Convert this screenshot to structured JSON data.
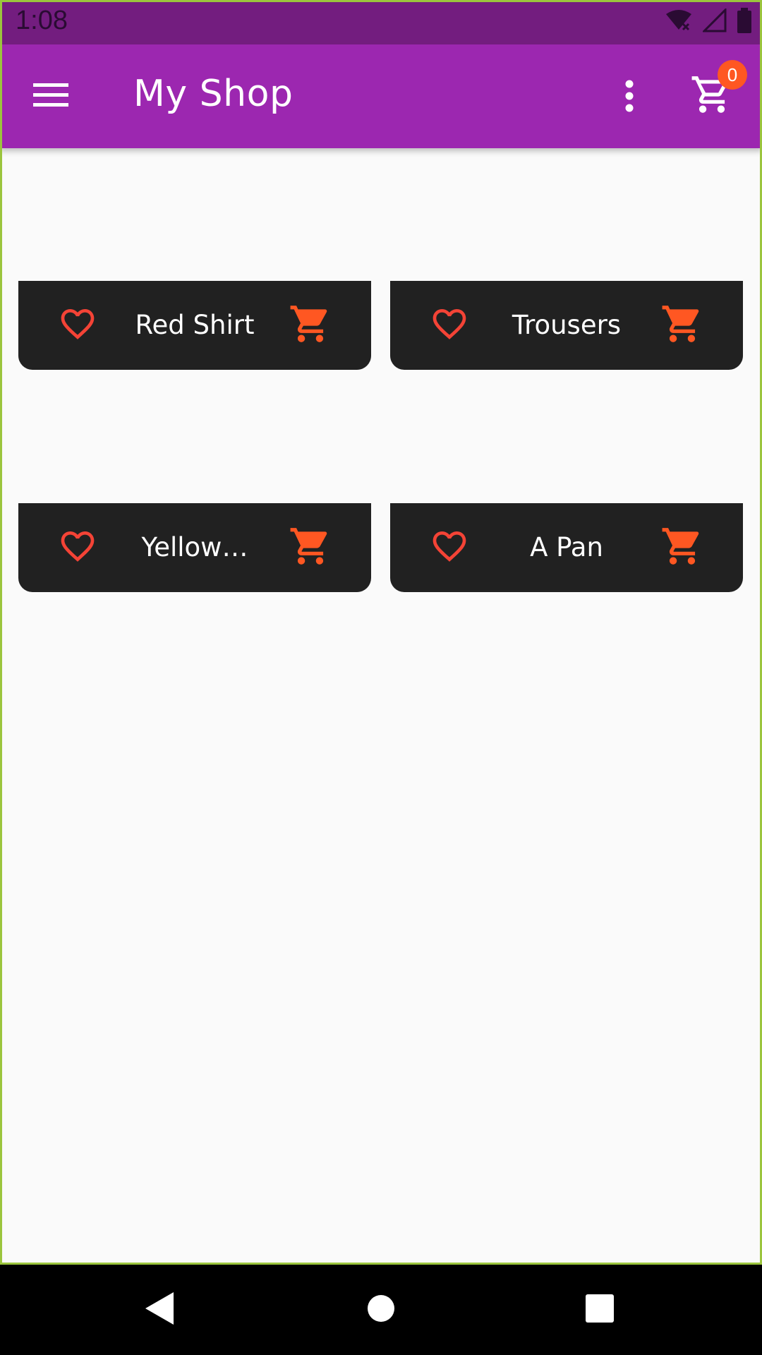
{
  "status_bar": {
    "time": "1:08",
    "icons": [
      "wifi-off-icon",
      "cell-signal-icon",
      "battery-icon"
    ]
  },
  "app_bar": {
    "title": "My Shop",
    "menu_icon": "hamburger-menu-icon",
    "overflow_icon": "more-vert-icon",
    "cart_icon": "shopping-cart-icon",
    "cart_count": "0"
  },
  "products": [
    {
      "name": "Red Shirt",
      "favorite_icon": "heart-outline-icon",
      "cart_icon": "add-shopping-cart-icon"
    },
    {
      "name": "Trousers",
      "favorite_icon": "heart-outline-icon",
      "cart_icon": "add-shopping-cart-icon"
    },
    {
      "name": "Yellow…",
      "favorite_icon": "heart-outline-icon",
      "cart_icon": "add-shopping-cart-icon"
    },
    {
      "name": "A Pan",
      "favorite_icon": "heart-outline-icon",
      "cart_icon": "add-shopping-cart-icon"
    }
  ],
  "nav_bar": {
    "icons": [
      "back-icon",
      "home-icon",
      "recents-icon"
    ]
  },
  "colors": {
    "status_bar": "#731d7f",
    "app_bar": "#9c27b0",
    "badge": "#ff5722",
    "tile": "#212121",
    "heart": "#f44336",
    "cart_accent": "#ff5722",
    "background": "#fafafa"
  }
}
